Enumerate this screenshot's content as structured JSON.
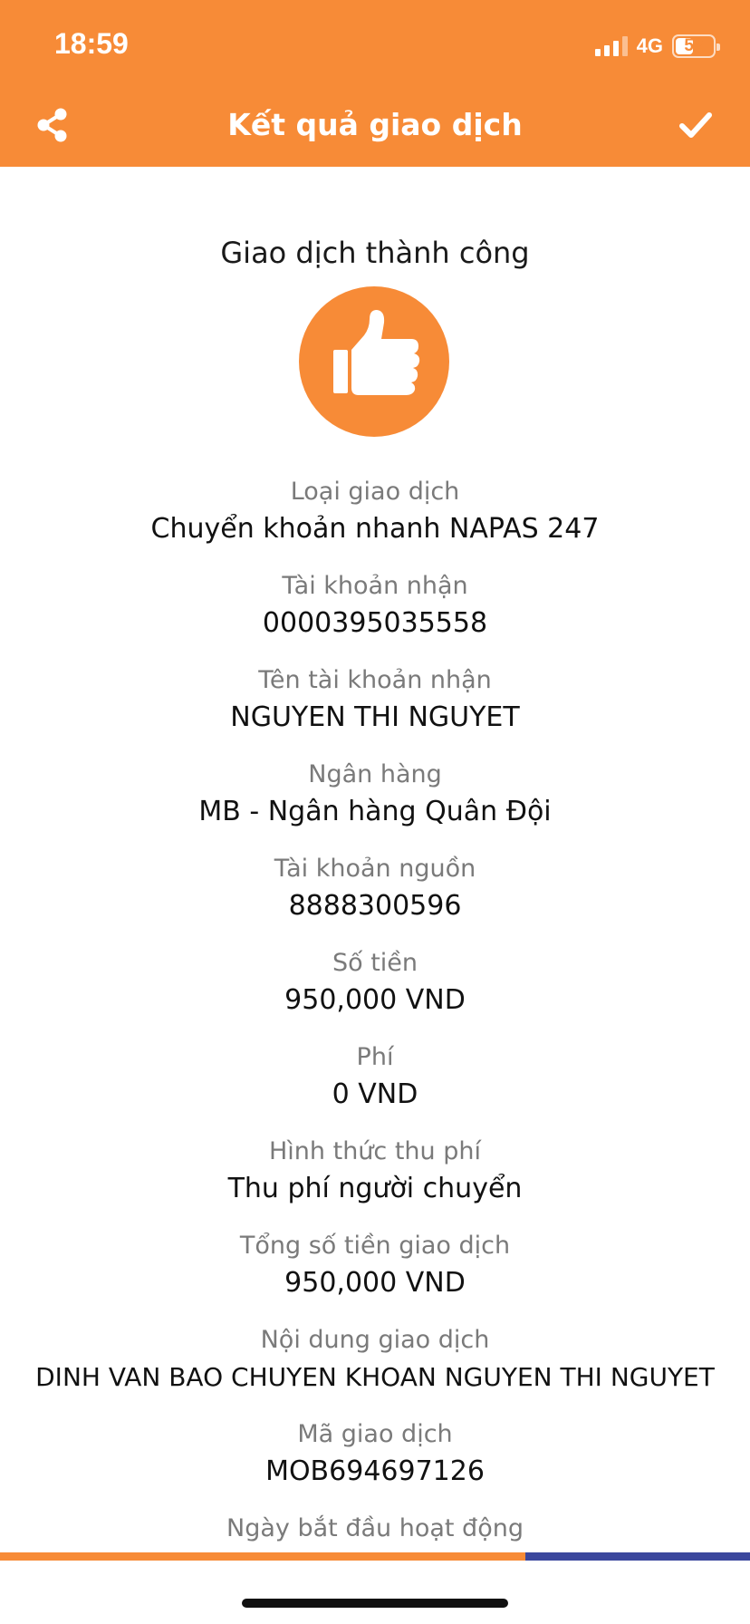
{
  "status_bar": {
    "time": "18:59",
    "network": "4G",
    "battery": "52",
    "battery_level": 0.52
  },
  "header": {
    "title": "Kết quả giao dịch",
    "share_icon": "share-icon",
    "confirm_icon": "checkmark-icon"
  },
  "result": {
    "title": "Giao dịch thành công",
    "icon": "thumbs-up-icon",
    "icon_color": "#f78b37"
  },
  "fields": [
    {
      "label": "Loại giao dịch",
      "value": "Chuyển khoản nhanh NAPAS 247"
    },
    {
      "label": "Tài khoản nhận",
      "value": "0000395035558"
    },
    {
      "label": "Tên tài khoản nhận",
      "value": "NGUYEN THI NGUYET"
    },
    {
      "label": "Ngân hàng",
      "value": "MB - Ngân hàng Quân Đội"
    },
    {
      "label": "Tài khoản nguồn",
      "value": "8888300596"
    },
    {
      "label": "Số tiền",
      "value": "950,000 VND"
    },
    {
      "label": "Phí",
      "value": "0 VND"
    },
    {
      "label": "Hình thức thu phí",
      "value": "Thu phí người chuyển"
    },
    {
      "label": "Tổng số tiền giao dịch",
      "value": "950,000 VND"
    },
    {
      "label": "Nội dung giao dịch",
      "value": "DINH VAN BAO CHUYEN KHOAN NGUYEN THI NGUYET"
    },
    {
      "label": "Mã giao dịch",
      "value": "MOB694697126"
    },
    {
      "label": "Ngày bắt đầu hoạt động",
      "value": ""
    }
  ],
  "colors": {
    "header": "#f78b37",
    "bar_orange": "#f78b37",
    "bar_blue": "#3b479d"
  }
}
